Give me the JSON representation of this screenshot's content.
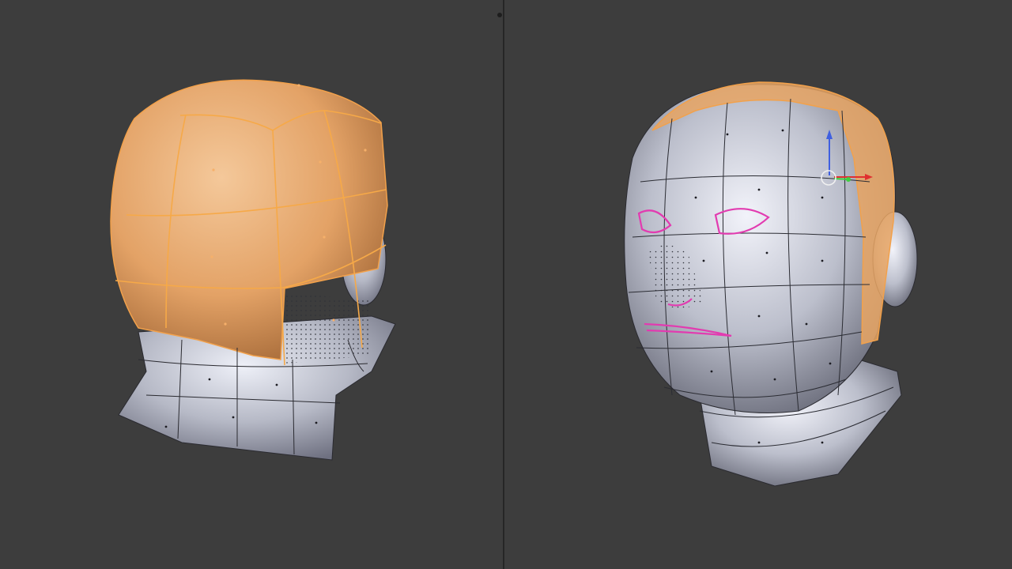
{
  "editor": {
    "mode": "edit-mode",
    "selection_color": "#f0a24c",
    "seam_color": "#e23bb0",
    "mesh_base_color": "#b9bcc9",
    "background_color": "#3d3d3d"
  },
  "viewports": [
    {
      "id": "left",
      "view": "back-three-quarter"
    },
    {
      "id": "right",
      "view": "front-three-quarter"
    }
  ],
  "gizmo": {
    "icons": [
      "translate-gizmo-icon",
      "z-axis-arrow-icon",
      "y-axis-arrow-icon",
      "x-axis-arrow-icon"
    ]
  }
}
